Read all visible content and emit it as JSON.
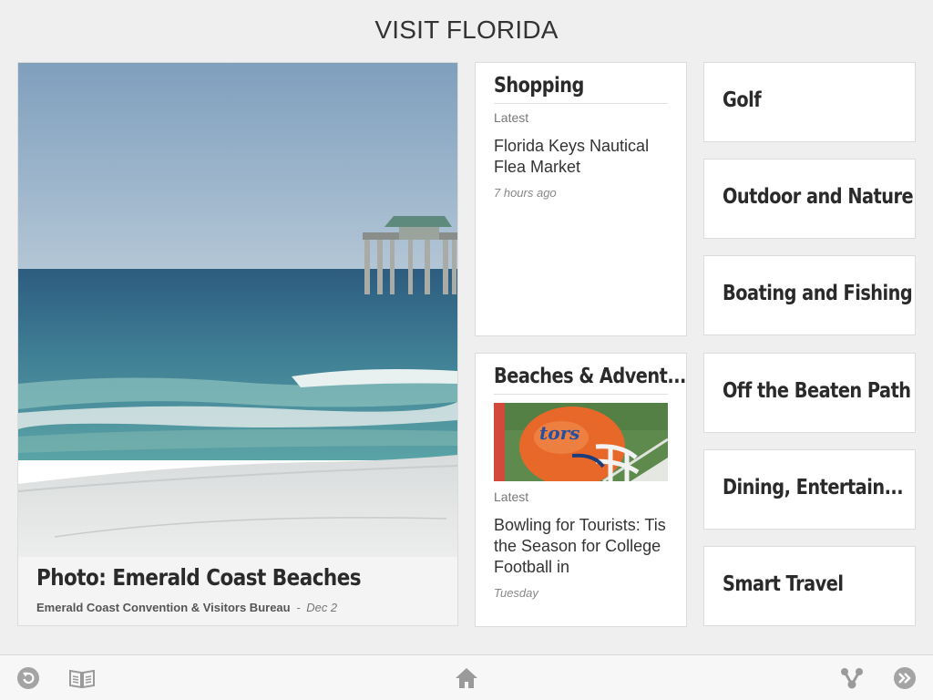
{
  "app": {
    "title": "VISIT FLORIDA"
  },
  "hero": {
    "title": "Photo: Emerald Coast Beaches",
    "source": "Emerald Coast Convention & Visitors Bureau",
    "separator": "-",
    "date": "Dec 2"
  },
  "sections": {
    "shopping": {
      "name": "Shopping",
      "latest_label": "Latest",
      "headline": "Florida Keys Nautical Flea Market",
      "time": "7 hours ago"
    },
    "beaches": {
      "name": "Beaches & Advent...",
      "latest_label": "Latest",
      "headline": "Bowling for Tourists: Tis the Season for College Football in",
      "time": "Tuesday"
    }
  },
  "categories": [
    {
      "label": "Golf"
    },
    {
      "label": "Outdoor and Nature"
    },
    {
      "label": "Boating and Fishing"
    },
    {
      "label": "Off the Beaten Path"
    },
    {
      "label": "Dining, Entertain..."
    },
    {
      "label": "Smart Travel"
    }
  ],
  "toolbar": {
    "icons": [
      "refresh-icon",
      "contents-icon",
      "home-icon",
      "share-icon",
      "forward-icon"
    ]
  },
  "colors": {
    "background": "#efefef",
    "text": "#2a2a2a",
    "icon": "#9a9a9a"
  }
}
